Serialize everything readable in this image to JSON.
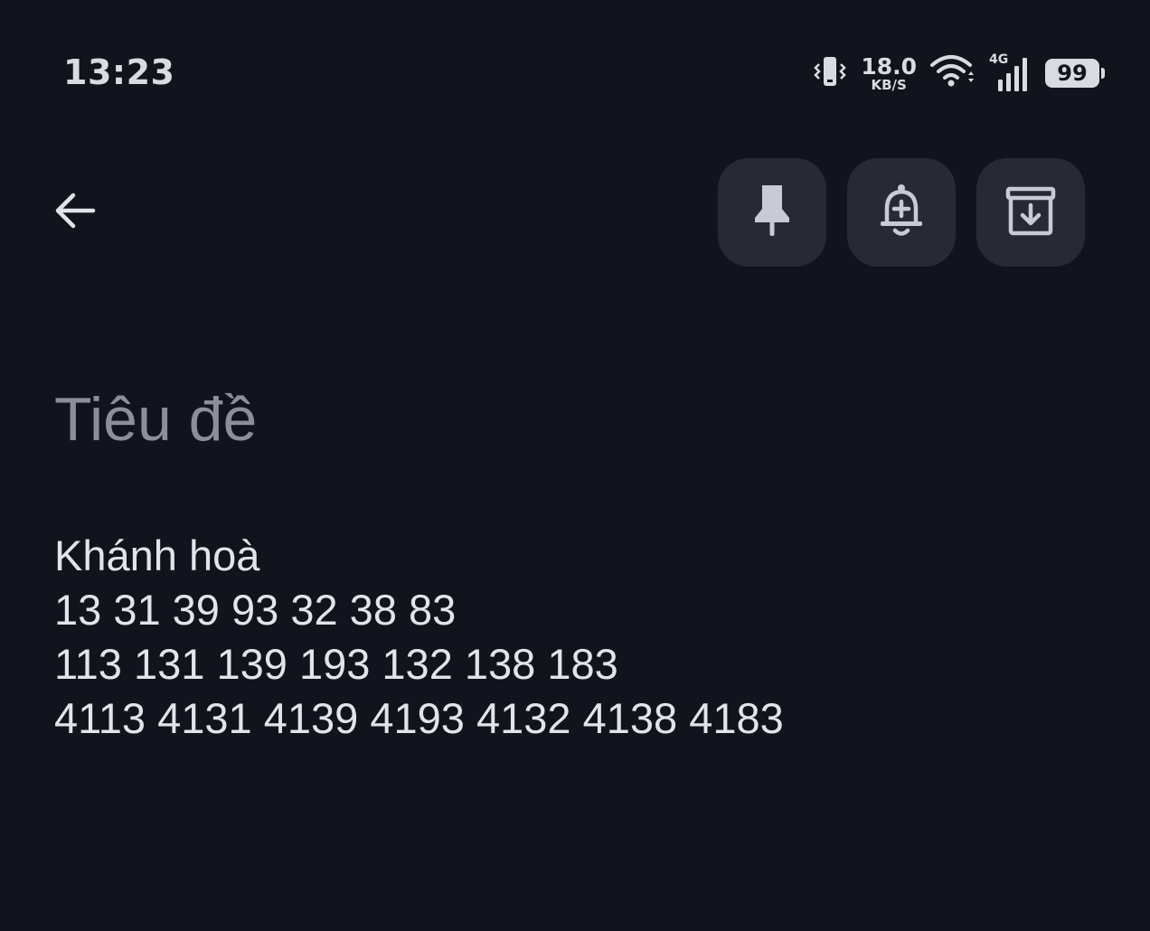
{
  "status_bar": {
    "time": "13:23",
    "net_speed_value": "18.0",
    "net_speed_unit": "KB/S",
    "network_type": "4G",
    "battery_level": "99",
    "icons": [
      "vibrate-icon",
      "wifi-icon",
      "cellular-signal-icon",
      "battery-icon"
    ]
  },
  "toolbar": {
    "back_icon": "arrow-left-icon",
    "actions": [
      {
        "icon": "pin-icon"
      },
      {
        "icon": "bell-plus-icon"
      },
      {
        "icon": "archive-icon"
      }
    ]
  },
  "note": {
    "title_placeholder": "Tiêu đề",
    "title_value": "",
    "body_lines": [
      "Khánh hoà",
      "13 31 39 93 32 38 83",
      "113 131 139 193 132 138 183",
      "4113 4131 4139 4193 4132 4138 4183"
    ]
  },
  "colors": {
    "background": "#11141d",
    "button_bg": "#272a35",
    "text_primary": "#e3e4ea",
    "text_placeholder": "#8c8f9a",
    "icon": "#c8cad6"
  }
}
